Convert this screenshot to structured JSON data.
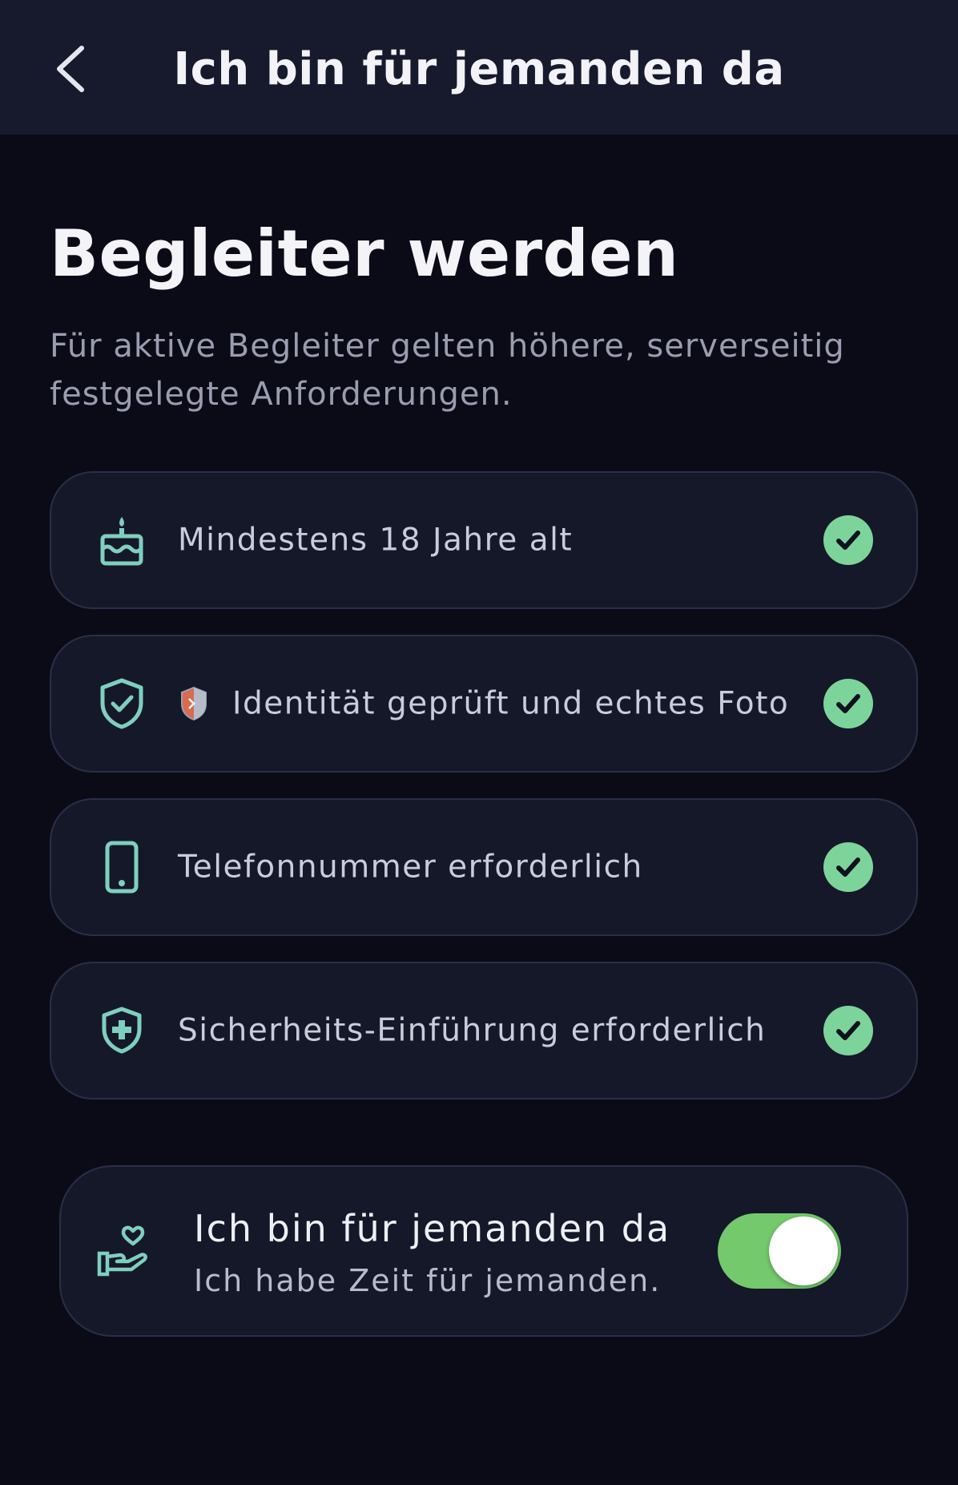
{
  "header": {
    "title": "Ich bin für jemanden da",
    "back_icon": "chevron-left-icon"
  },
  "hero": {
    "title": "Begleiter werden",
    "subtitle": "Für aktive Begleiter gelten höhere, serverseitig festgelegte Anforderungen."
  },
  "requirements": [
    {
      "icon": "cake-icon",
      "label": "Mindestens 18 Jahre alt",
      "status": "fulfilled"
    },
    {
      "icon": "shield-check-icon",
      "badge_icon": "shield-badge-icon",
      "label": "Identität geprüft und echtes Foto",
      "status": "fulfilled"
    },
    {
      "icon": "phone-icon",
      "label": "Telefonnummer erforderlich",
      "status": "fulfilled"
    },
    {
      "icon": "shield-plus-icon",
      "label": "Sicherheits-Einführung erforderlich",
      "status": "fulfilled"
    }
  ],
  "availability": {
    "icon": "hand-heart-icon",
    "title": "Ich bin für jemanden da",
    "subtitle": "Ich habe Zeit für jemanden.",
    "enabled": true
  },
  "colors": {
    "background": "#0b0b17",
    "header": "#161a2c",
    "card": "#151829",
    "card_border": "#2a2f48",
    "accent_teal": "#7ecfc0",
    "check_green": "#7dd49b",
    "toggle_green": "#74c96d"
  }
}
